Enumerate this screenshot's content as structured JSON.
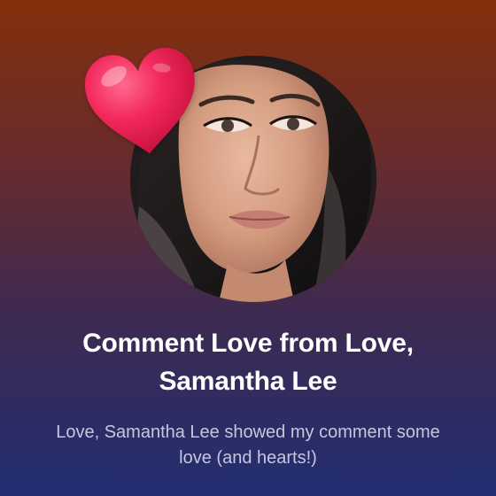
{
  "notification": {
    "title": "Comment Love from Love, Samantha Lee",
    "message": "Love, Samantha Lee showed my comment some love (and hearts!)"
  },
  "avatar": {
    "image": "profile-photo"
  },
  "badge": {
    "icon": "heart-icon",
    "color": "#f2295c"
  },
  "colors": {
    "background_top": "#832f0c",
    "background_bottom": "#222e72",
    "title": "#ffffff",
    "message": "#c8c6dc"
  }
}
